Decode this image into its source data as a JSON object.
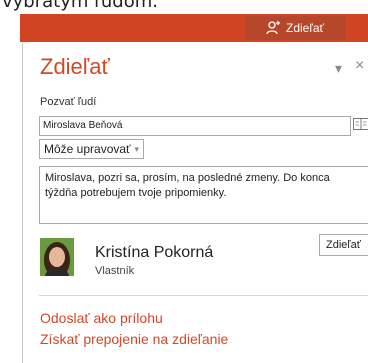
{
  "caption": "vybratým ľudom.",
  "ribbon": {
    "share_button_label": "Zdieľať",
    "accent": "#d04423"
  },
  "panel": {
    "title": "Zdieľať",
    "dropdown_glyph": "▾",
    "close_glyph": "×",
    "invite_label": "Pozvať ľudí",
    "name_input_value": "Miroslava Beňová",
    "permission_value": "Môže upravovať",
    "message": "Miroslava, pozri sa, prosím, na posledné zmeny. Do konca týždňa potrebujem tvoje pripomienky.",
    "share_button_label": "Zdieľať"
  },
  "person": {
    "name": "Kristína Pokorná",
    "role": "Vlastník"
  },
  "links": {
    "send_attachment": "Odoslať ako prílohu",
    "get_link": "Získať prepojenie na zdieľanie"
  },
  "icons": [
    "person-add-icon",
    "address-book-icon",
    "chevron-down-icon",
    "close-icon",
    "avatar"
  ],
  "colors": {
    "accent_text": "#d24726"
  }
}
